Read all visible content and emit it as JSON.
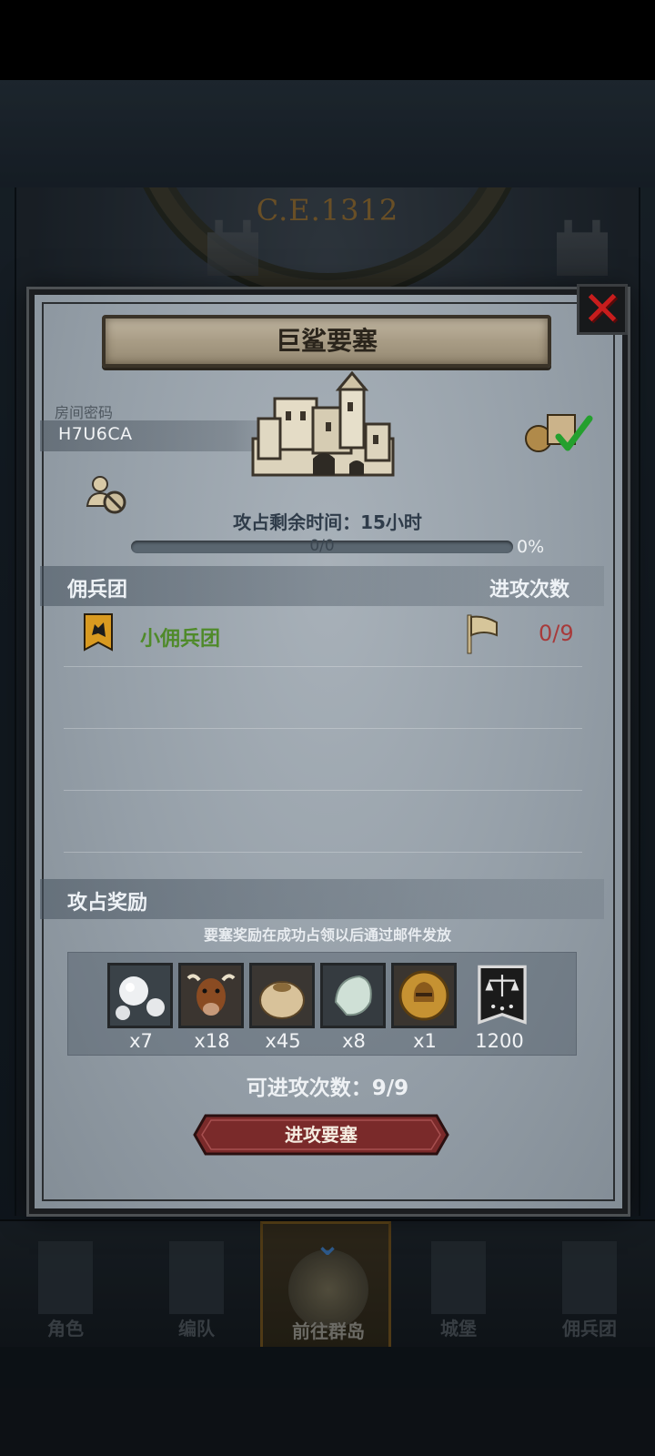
{
  "header": {
    "era": "C.E.1312"
  },
  "modal": {
    "title": "巨鲨要塞",
    "room": {
      "label": "房间密码",
      "code": "H7U6CA"
    },
    "timer": "攻占剩余时间：15小时",
    "progress": {
      "text": "0/0",
      "percent_label": "0%",
      "fraction": 0
    },
    "mercenary_section": {
      "left_header": "佣兵团",
      "right_header": "进攻次数"
    },
    "mercenaries": [
      {
        "name": "小佣兵团",
        "attacks": "0/9"
      }
    ],
    "rewards_section": {
      "title": "攻占奖励",
      "note": "要塞奖励在成功占领以后通过邮件发放",
      "items": [
        {
          "icon": "pearls-icon",
          "qty": "x7"
        },
        {
          "icon": "cattle-icon",
          "qty": "x18"
        },
        {
          "icon": "grain-sack-icon",
          "qty": "x45"
        },
        {
          "icon": "gemstone-icon",
          "qty": "x8"
        },
        {
          "icon": "knight-medal-icon",
          "qty": "x1"
        },
        {
          "icon": "justice-banner-icon",
          "qty": "1200"
        }
      ]
    },
    "attempts": "可进攻次数：9/9",
    "attack_button": "进攻要塞"
  },
  "nav": {
    "tabs": [
      {
        "label": "角色",
        "icon": "knight-icon"
      },
      {
        "label": "编队",
        "icon": "helmet-icon"
      },
      {
        "label": "前往群岛",
        "icon": "globe-icon",
        "active": true
      },
      {
        "label": "城堡",
        "icon": "castle-icon"
      },
      {
        "label": "佣兵团",
        "icon": "soldier-icon"
      }
    ]
  },
  "colors": {
    "accent_red": "#c81d1d",
    "merc_green": "#4f8a2a",
    "count_red": "#a83a3a"
  }
}
